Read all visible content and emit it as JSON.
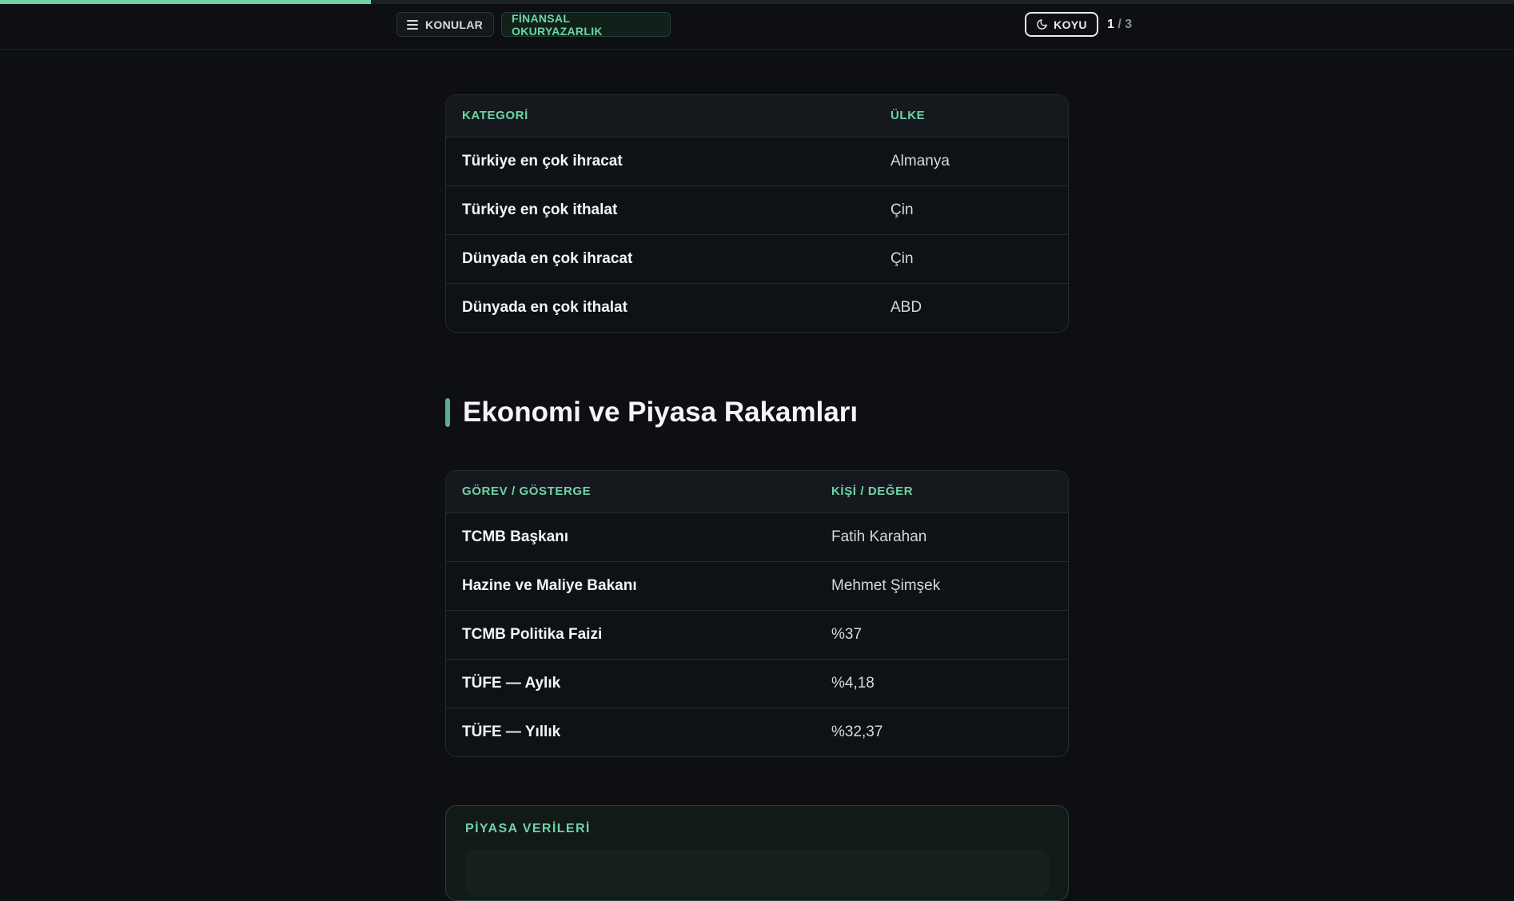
{
  "progress": {
    "fraction": 0.245
  },
  "topbar": {
    "topics_label": "KONULAR",
    "category_label": "FİNANSAL OKURYAZARLIK",
    "theme_label": "KOYU",
    "page_current": "1",
    "page_sep": "/",
    "page_total": "3"
  },
  "trade_table": {
    "headers": [
      "KATEGORİ",
      "ÜLKE"
    ],
    "rows": [
      [
        "Türkiye en çok ihracat",
        "Almanya"
      ],
      [
        "Türkiye en çok ithalat",
        "Çin"
      ],
      [
        "Dünyada en çok ihracat",
        "Çin"
      ],
      [
        "Dünyada en çok ithalat",
        "ABD"
      ]
    ]
  },
  "section": {
    "title": "Ekonomi ve Piyasa Rakamları"
  },
  "economy_table": {
    "headers": [
      "GÖREV / GÖSTERGE",
      "KİŞİ / DEĞER"
    ],
    "rows": [
      [
        "TCMB Başkanı",
        "Fatih Karahan"
      ],
      [
        "Hazine ve Maliye Bakanı",
        "Mehmet Şimşek"
      ],
      [
        "TCMB Politika Faizi",
        "%37"
      ],
      [
        "TÜFE — Aylık",
        "%4,18"
      ],
      [
        "TÜFE — Yıllık",
        "%32,37"
      ]
    ]
  },
  "market_card": {
    "title": "PİYASA VERİLERİ"
  }
}
